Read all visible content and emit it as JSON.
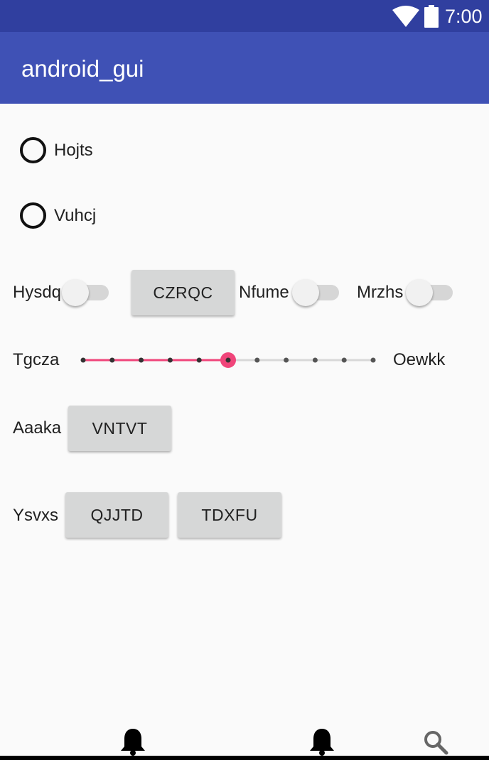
{
  "status_bar": {
    "time": "7:00",
    "icons": [
      "wifi-icon",
      "battery-icon"
    ]
  },
  "app_bar": {
    "title": "android_gui"
  },
  "radios": [
    {
      "label": "Hojts",
      "checked": false
    },
    {
      "label": "Vuhcj",
      "checked": false
    }
  ],
  "row_switches": {
    "switch1_label": "Hysdq",
    "button_label": "CZRQC",
    "switch2_label": "Nfume",
    "switch3_label": "Mrzhs",
    "switch1_on": false,
    "switch2_on": false,
    "switch3_on": false
  },
  "slider_row": {
    "left_label": "Tgcza",
    "right_label": "Oewkk",
    "steps": 10,
    "value": 5
  },
  "row_aaaka": {
    "label": "Aaaka",
    "button_label": "VNTVT"
  },
  "row_ysvxs": {
    "label": "Ysvxs",
    "button1_label": "QJJTD",
    "button2_label": "TDXFU"
  },
  "bottom_nav": {
    "icons": [
      "bell-icon",
      "bell-icon",
      "search-icon"
    ]
  },
  "colors": {
    "status_bar": "#303f9f",
    "app_bar": "#3f51b5",
    "accent": "#f0457a",
    "background": "#fafafa"
  }
}
